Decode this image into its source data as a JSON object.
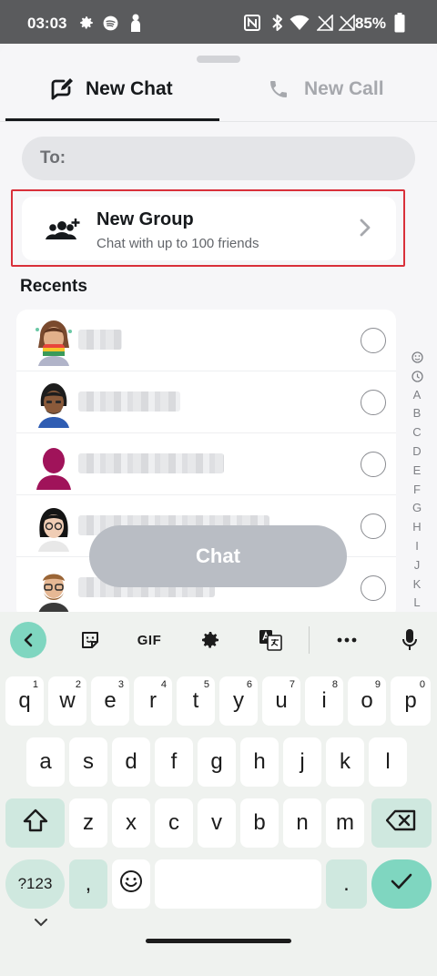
{
  "status_bar": {
    "time": "03:03",
    "battery": "85%",
    "icons": [
      "gear-icon",
      "spotify-icon",
      "person-icon",
      "nfc-icon",
      "bluetooth-icon",
      "wifi-icon",
      "no-signal-icon",
      "no-signal-icon",
      "battery-icon"
    ]
  },
  "tabs": [
    {
      "label": "New Chat",
      "icon": "compose-icon",
      "active": true
    },
    {
      "label": "New Call",
      "icon": "phone-icon",
      "active": false
    }
  ],
  "to_field": {
    "label": "To:"
  },
  "new_group": {
    "title": "New Group",
    "subtitle": "Chat with up to 100 friends",
    "icon": "add-group-icon"
  },
  "recents": {
    "heading": "Recents",
    "rows": [
      {
        "avatar": "bitmoji-avatar",
        "name_redacted": true,
        "selected": false
      },
      {
        "avatar": "bitmoji-avatar",
        "name_redacted": true,
        "selected": false
      },
      {
        "avatar": "default-avatar",
        "name_redacted": true,
        "selected": false
      },
      {
        "avatar": "bitmoji-avatar",
        "name_redacted": true,
        "selected": false
      },
      {
        "avatar": "bitmoji-avatar",
        "name_redacted": true,
        "selected": false
      }
    ]
  },
  "alpha_index": [
    "A",
    "B",
    "C",
    "D",
    "E",
    "F",
    "G",
    "H",
    "I",
    "J",
    "K",
    "L"
  ],
  "chat_button": {
    "label": "Chat"
  },
  "keyboard": {
    "toolbar": {
      "gif": "GIF"
    },
    "row1": [
      {
        "k": "q",
        "n": "1"
      },
      {
        "k": "w",
        "n": "2"
      },
      {
        "k": "e",
        "n": "3"
      },
      {
        "k": "r",
        "n": "4"
      },
      {
        "k": "t",
        "n": "5"
      },
      {
        "k": "y",
        "n": "6"
      },
      {
        "k": "u",
        "n": "7"
      },
      {
        "k": "i",
        "n": "8"
      },
      {
        "k": "o",
        "n": "9"
      },
      {
        "k": "p",
        "n": "0"
      }
    ],
    "row2": [
      "a",
      "s",
      "d",
      "f",
      "g",
      "h",
      "j",
      "k",
      "l"
    ],
    "row3": [
      "z",
      "x",
      "c",
      "v",
      "b",
      "n",
      "m"
    ],
    "symbols": "?123",
    "comma": ",",
    "period": ".",
    "colors": {
      "accent": "#7fd6c0",
      "function_key": "#cfe8df",
      "background": "#eff2ef"
    }
  },
  "colors": {
    "highlight": "#d9303a",
    "chat_button": "#b9bdc4",
    "status_bar": "#5a5b5d"
  }
}
